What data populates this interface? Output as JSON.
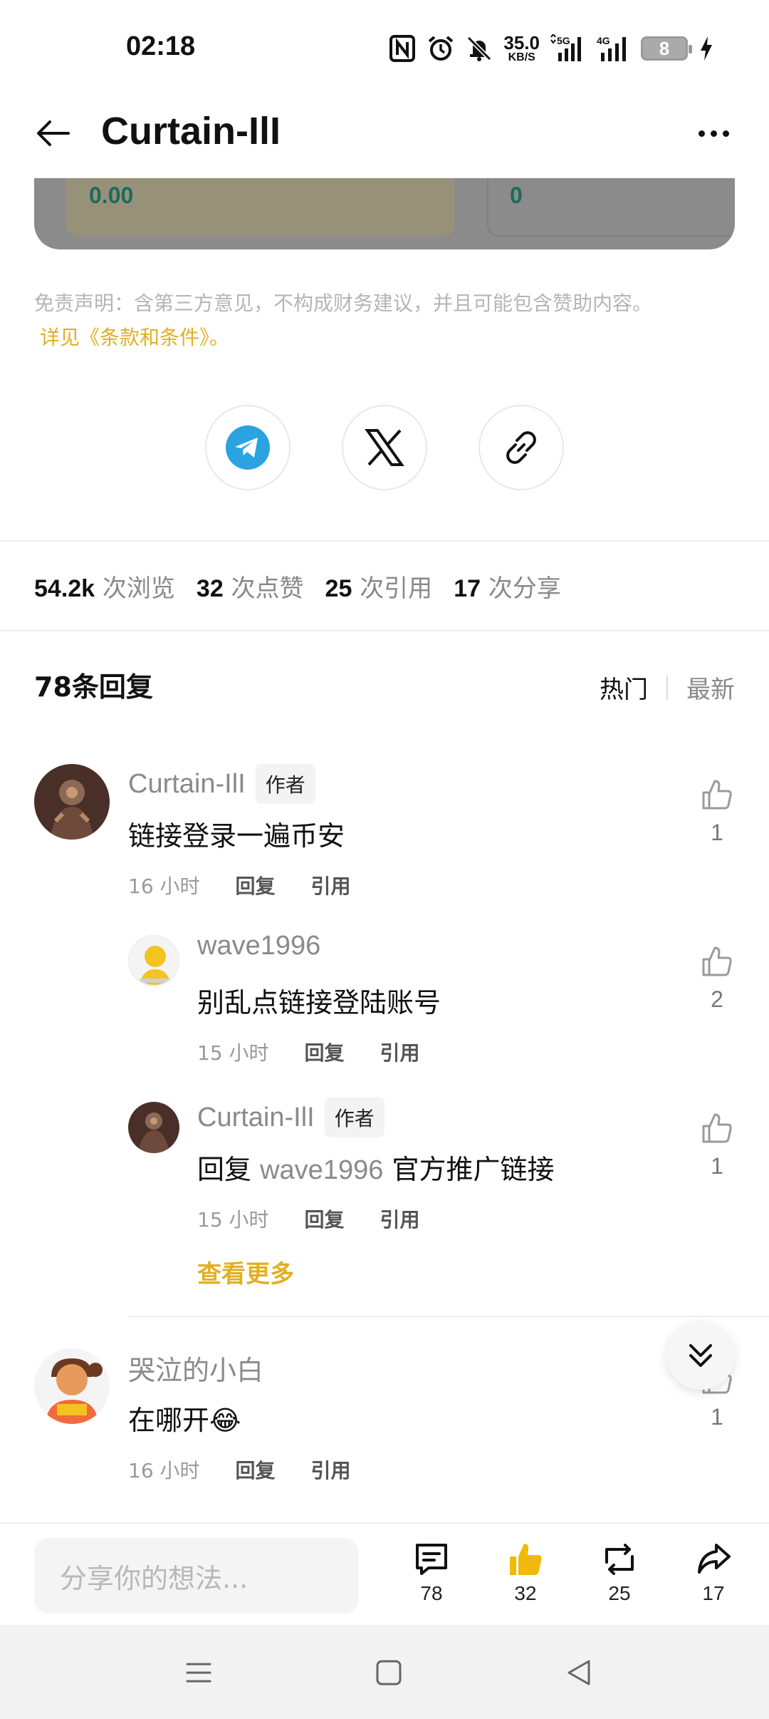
{
  "status_bar": {
    "time": "02:18",
    "net_speed_value": "35.0",
    "net_speed_unit": "KB/S",
    "signal1_label": "5G",
    "signal2_label": "4G",
    "battery_level": "8",
    "icons": [
      "nfc-icon",
      "alarm-icon",
      "mute-bell-icon",
      "signal-5g-icon",
      "signal-4g-icon",
      "battery-icon",
      "charging-icon"
    ]
  },
  "header": {
    "title": "Curtain-IlI"
  },
  "price_card": {
    "left_value": "0.00",
    "right_value": "0"
  },
  "disclaimer": {
    "text": "免责声明：含第三方意见，不构成财务建议，并且可能包含赞助内容。",
    "link": "详见《条款和条件》。"
  },
  "stats": [
    {
      "num": "54.2k",
      "label": "次浏览"
    },
    {
      "num": "32",
      "label": "次点赞"
    },
    {
      "num": "25",
      "label": "次引用"
    },
    {
      "num": "17",
      "label": "次分享"
    }
  ],
  "replies": {
    "title": "78条回复",
    "sort_hot": "热门",
    "sort_new": "最新",
    "see_more": "查看更多"
  },
  "comments": [
    {
      "name": "Curtain-IlI",
      "badge": "作者",
      "text": "链接登录一遍币安",
      "time": "16 小时",
      "reply": "回复",
      "quote": "引用",
      "likes": "1"
    },
    {
      "name": "wave1996",
      "text": "别乱点链接登陆账号",
      "time": "15 小时",
      "reply": "回复",
      "quote": "引用",
      "likes": "2"
    },
    {
      "name": "Curtain-IlI",
      "badge": "作者",
      "text_prefix": "回复",
      "mention": "wave1996",
      "text": "官方推广链接",
      "time": "15 小时",
      "reply": "回复",
      "quote": "引用",
      "likes": "1"
    },
    {
      "name": "哭泣的小白",
      "text": "在哪开😂",
      "time": "16 小时",
      "reply": "回复",
      "quote": "引用",
      "likes": "1"
    }
  ],
  "bottom_bar": {
    "placeholder": "分享你的想法...",
    "comments": "78",
    "likes": "32",
    "reposts": "25",
    "shares": "17",
    "like_active_color": "#F0B90B"
  },
  "colors": {
    "accent": "#E0B023",
    "telegram": "#2AA3E0"
  }
}
